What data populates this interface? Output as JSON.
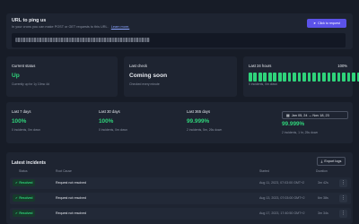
{
  "url_card": {
    "title": "URL to ping us",
    "description": "In your crons you can make POST or GET requests to this URL.",
    "link": "Learn more.",
    "button_label": "Click to request"
  },
  "current_status": {
    "label": "Current status",
    "value": "Up",
    "sub": "Currently up for 1y 10mo 4d"
  },
  "last_check": {
    "label": "Last check",
    "value": "Coming soon",
    "sub": "Checked every minute"
  },
  "last_24h": {
    "label": "Last 24 hours",
    "percent": "100%",
    "sub": "0 incidents, 0m down",
    "bar_count": 24,
    "bar_color": "#2fd37a"
  },
  "uptime": [
    {
      "label": "Last 7 days",
      "value": "100%",
      "sub": "0 incidents, 0m down"
    },
    {
      "label": "Last 30 days",
      "value": "100%",
      "sub": "0 incidents, 0m down"
    },
    {
      "label": "Last 365 days",
      "value": "99.999%",
      "sub": "2 incidents, 5m, 26s down"
    },
    {
      "label": "",
      "value": "99.999%",
      "sub": "2 incidents, 1 hr, 25s down"
    }
  ],
  "date_range": {
    "value": "Jan 05, 24 → Nov 18, 23"
  },
  "incidents": {
    "title": "Latest incidents",
    "export_label": "Export logs",
    "columns": [
      "Status",
      "Root Cause",
      "Started",
      "Duration"
    ],
    "rows": [
      {
        "status": "Resolved",
        "cause": "Request not resolved",
        "started": "Aug 11, 2023, 07:03:00 GMT+2",
        "duration": "3m 42s"
      },
      {
        "status": "Resolved",
        "cause": "Request not resolved",
        "started": "Aug 13, 2023, 07:03:00 GMT+2",
        "duration": "6m 38s"
      },
      {
        "status": "Resolved",
        "cause": "Request not resolved",
        "started": "Aug 17, 2023, 17:40:50 GMT+2",
        "duration": "3m 34s"
      }
    ]
  },
  "colors": {
    "accent": "#5b52e8",
    "success": "#2fd37a",
    "background": "#171c27",
    "card": "#1e2431"
  }
}
